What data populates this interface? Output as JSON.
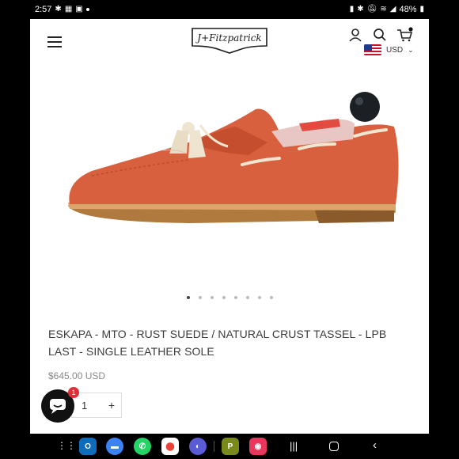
{
  "status_bar": {
    "time": "2:57",
    "battery": "48%"
  },
  "header": {
    "logo_text": "J+Fitzpatrick",
    "currency": "USD"
  },
  "carousel": {
    "count": 8,
    "active": 0
  },
  "product": {
    "title": "ESKAPA - MTO - RUST SUEDE / NATURAL CRUST TASSEL - LPB LAST - SINGLE LEATHER SOLE",
    "price": "$645.00 USD",
    "quantity": "1",
    "plus": "+"
  },
  "chat": {
    "badge": "1"
  },
  "icons": [
    "menu-icon",
    "account-icon",
    "search-icon",
    "cart-icon",
    "chat-icon"
  ],
  "colors": {
    "brand_dark": "#1a1a1a",
    "badge_red": "#e22d3a",
    "shoe_rust": "#d9603e"
  }
}
